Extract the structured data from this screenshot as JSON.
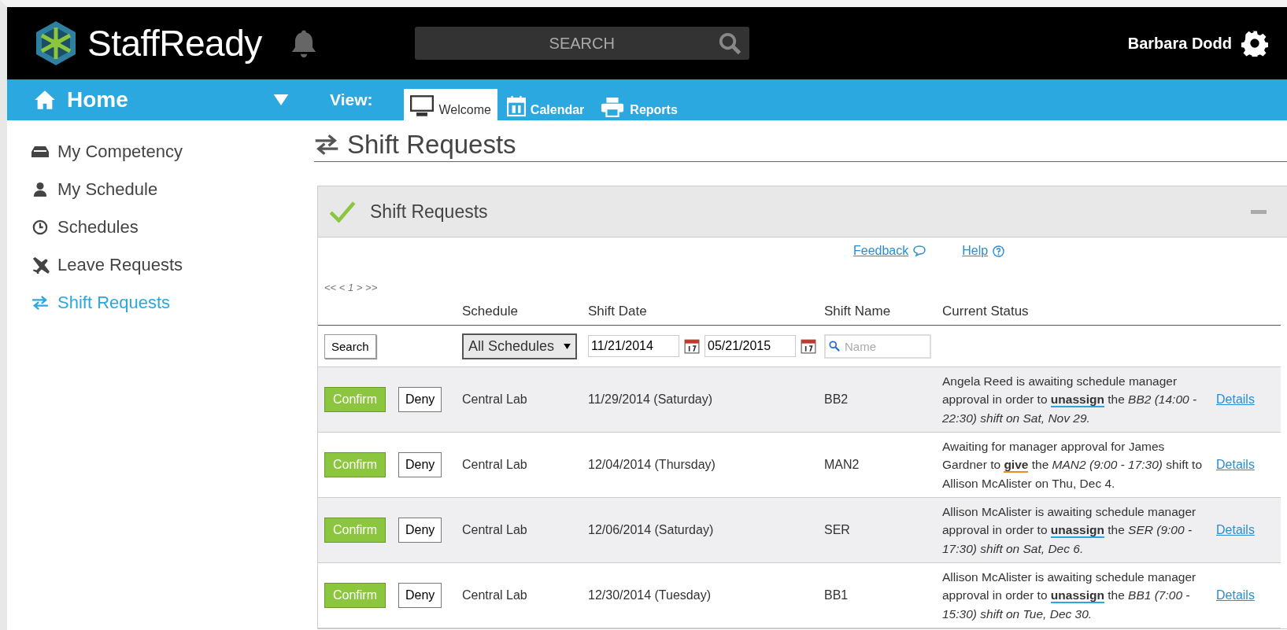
{
  "header": {
    "logo": "StaffReady",
    "search": {
      "placeholder": "SEARCH"
    },
    "user": "Barbara Dodd"
  },
  "navbar": {
    "home": "Home",
    "view_label": "View:",
    "tabs": [
      {
        "label": "Welcome",
        "selected": true
      },
      {
        "label": "Calendar",
        "selected": false
      },
      {
        "label": "Reports",
        "selected": false
      }
    ]
  },
  "sidebar": {
    "items": [
      {
        "label": "My Competency",
        "selected": false
      },
      {
        "label": "My Schedule",
        "selected": false
      },
      {
        "label": "Schedules",
        "selected": false
      },
      {
        "label": "Leave Requests",
        "selected": false
      },
      {
        "label": "Shift Requests",
        "selected": true
      }
    ]
  },
  "page_title": "Shift Requests",
  "panel": {
    "title": "Shift Requests",
    "links": [
      "Feedback",
      "Help"
    ],
    "pager": "<< < 1 > >>",
    "columns": [
      "Schedule",
      "Shift Date",
      "Shift Name",
      "Current Status"
    ],
    "filters": {
      "search_button": "Search",
      "schedule": "All Schedules",
      "date_from": "11/21/2014",
      "date_to": "05/21/2015",
      "name_placeholder": "Name"
    },
    "rows": [
      {
        "confirm": "Confirm",
        "deny": "Deny",
        "schedule": "Central Lab",
        "date": "11/29/2014 (Saturday)",
        "shift": "BB2",
        "status": "Angela Reed is awaiting schedule manager approval in order to **unassign** the *BB2 (14:00 - 22:30) shift on Sat, Nov 29.*",
        "color": "#29a8e0",
        "details": "Details"
      },
      {
        "confirm": "Confirm",
        "deny": "Deny",
        "schedule": "Central Lab",
        "date": "12/04/2014 (Thursday)",
        "shift": "MAN2",
        "status": "Awaiting for manager approval for James Gardner to **give** the *MAN2 (9:00 - 17:30)* shift to Allison McAlister on Thu, Dec 4.",
        "color": "#f08a24",
        "details": "Details"
      },
      {
        "confirm": "Confirm",
        "deny": "Deny",
        "schedule": "Central Lab",
        "date": "12/06/2014 (Saturday)",
        "shift": "SER",
        "status": "Allison McAlister is awaiting schedule manager approval in order to **unassign** the *SER (9:00 - 17:30) shift on Sat, Dec 6.*",
        "color": "#29a8e0",
        "details": "Details"
      },
      {
        "confirm": "Confirm",
        "deny": "Deny",
        "schedule": "Central Lab",
        "date": "12/30/2014 (Tuesday)",
        "shift": "BB1",
        "status": "Allison McAlister is awaiting schedule manager approval in order to **unassign** the *BB1 (7:00 - 15:30) shift on Tue, Dec 30.*",
        "color": "#29a8e0",
        "details": "Details"
      }
    ]
  }
}
